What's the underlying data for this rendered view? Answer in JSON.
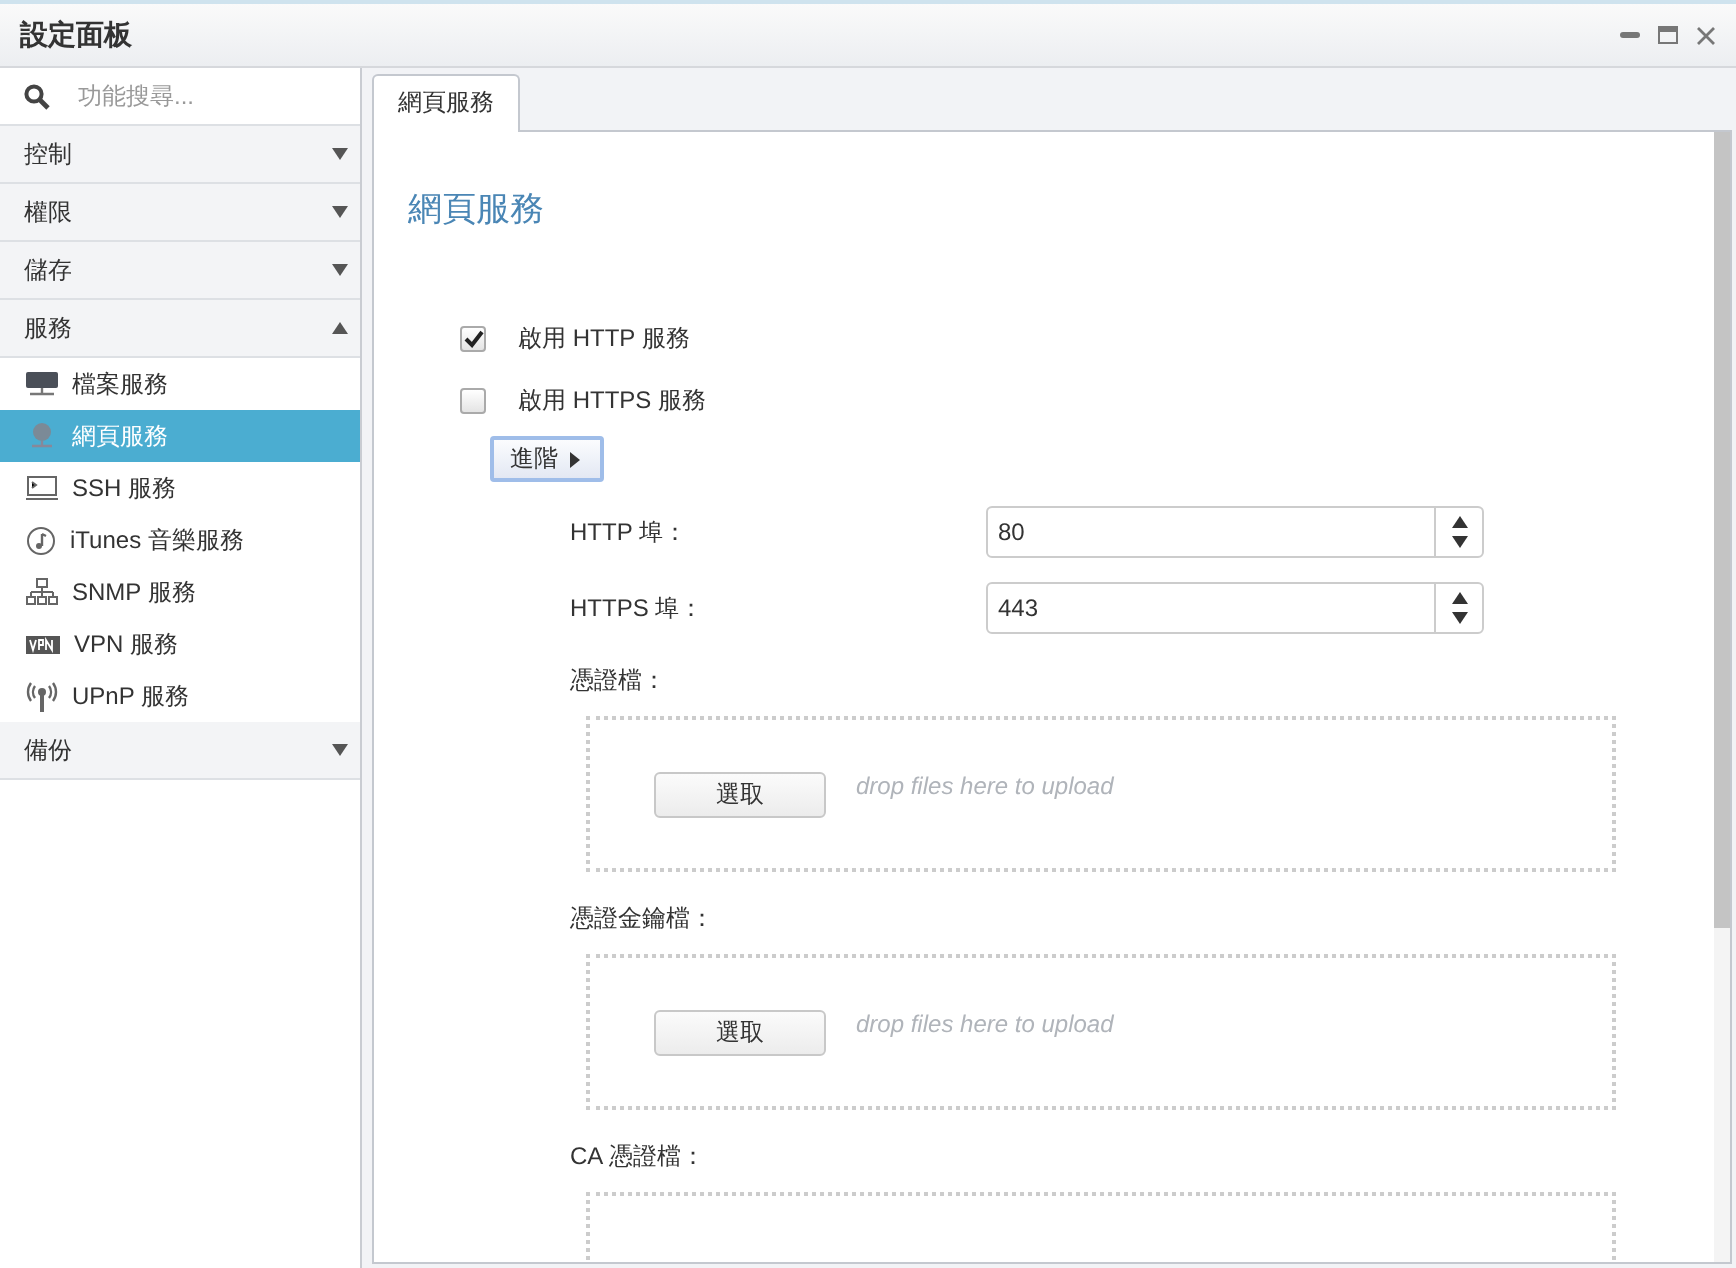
{
  "window": {
    "title": "設定面板"
  },
  "search": {
    "placeholder": "功能搜尋..."
  },
  "sidebar": {
    "items": [
      {
        "label": "控制",
        "expanded": false
      },
      {
        "label": "權限",
        "expanded": false
      },
      {
        "label": "儲存",
        "expanded": false
      },
      {
        "label": "服務",
        "expanded": true,
        "children": [
          {
            "label": "檔案服務",
            "kind": "file",
            "selected": false
          },
          {
            "label": "網頁服務",
            "kind": "web",
            "selected": true
          },
          {
            "label": "SSH 服務",
            "kind": "ssh",
            "selected": false
          },
          {
            "label": "iTunes 音樂服務",
            "kind": "music",
            "selected": false
          },
          {
            "label": "SNMP 服務",
            "kind": "snmp",
            "selected": false
          },
          {
            "label": "VPN 服務",
            "kind": "vpn",
            "selected": false
          },
          {
            "label": "UPnP 服務",
            "kind": "upnp",
            "selected": false
          }
        ]
      },
      {
        "label": "備份",
        "expanded": false
      }
    ]
  },
  "tabs": [
    {
      "label": "網頁服務",
      "selected": true
    }
  ],
  "page": {
    "heading": "網頁服務",
    "checkboxes": [
      {
        "label": "啟用 HTTP 服務",
        "checked": true
      },
      {
        "label": "啟用 HTTPS 服務",
        "checked": false
      }
    ],
    "advanced_button": "進階",
    "ports": [
      {
        "label": "HTTP 埠：",
        "value": "80"
      },
      {
        "label": "HTTPS 埠：",
        "value": "443"
      }
    ],
    "uploads": [
      {
        "label": "憑證檔：",
        "button": "選取",
        "hint": "drop files here to upload"
      },
      {
        "label": "憑證金鑰檔：",
        "button": "選取",
        "hint": "drop files here to upload"
      },
      {
        "label": "CA 憑證檔："
      }
    ]
  }
}
